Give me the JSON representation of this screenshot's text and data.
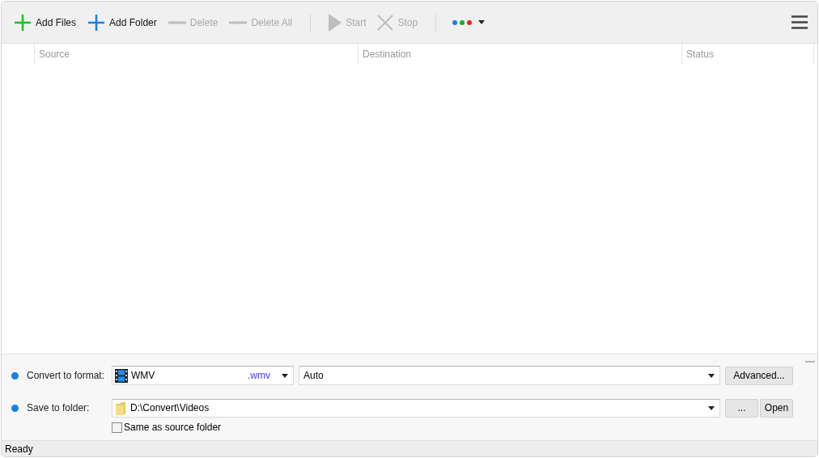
{
  "toolbar": {
    "items": [
      {
        "label": "Add Files",
        "kind": "plus",
        "color": "#22bb22",
        "disabled": false
      },
      {
        "label": "Add Folder",
        "kind": "plus",
        "color": "#1a7fe8",
        "disabled": false
      },
      {
        "label": "Delete",
        "kind": "minus",
        "disabled": true
      },
      {
        "label": "Delete All",
        "kind": "minus",
        "disabled": true
      },
      {
        "label": "Start",
        "kind": "play",
        "disabled": true
      },
      {
        "label": "Stop",
        "kind": "cross",
        "disabled": true
      }
    ]
  },
  "table": {
    "columns": [
      "Source",
      "Destination",
      "Status"
    ]
  },
  "options": {
    "format": {
      "label": "Convert to format:",
      "value": "WMV",
      "extension": ".wmv",
      "quality": "Auto",
      "button": "Advanced..."
    },
    "folder": {
      "label": "Save to folder:",
      "value": "D:\\Convert\\Videos",
      "browse": "...",
      "open": "Open"
    },
    "same_as_source": {
      "label": "Same as source folder",
      "checked": false
    }
  },
  "status_bar": "Ready"
}
